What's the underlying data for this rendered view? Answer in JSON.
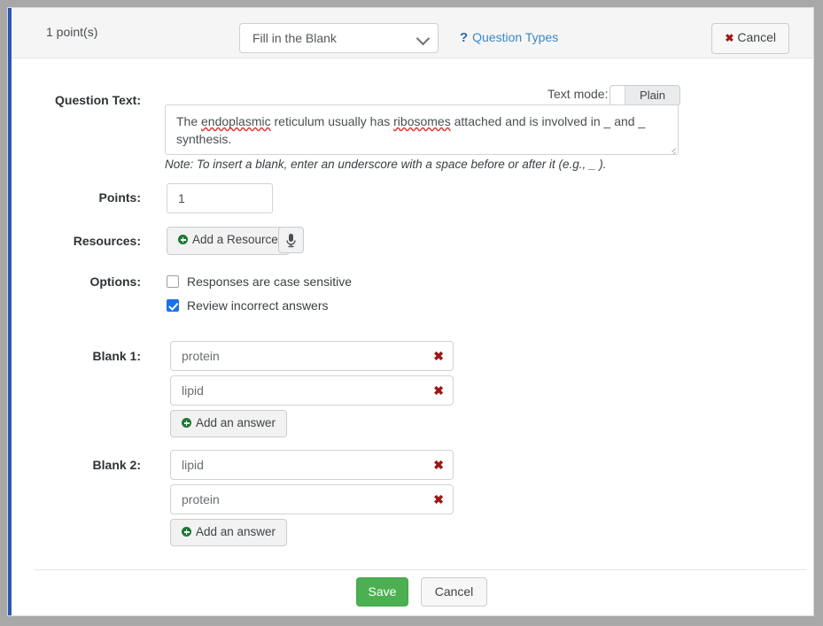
{
  "header": {
    "points_summary": "1 point(s)",
    "question_type": "Fill in the Blank",
    "question_types_link": "Question Types",
    "help_icon": "question-mark-icon",
    "cancel_label": "Cancel",
    "cancel_icon": "x-mark-icon",
    "chevron_icon": "chevron-down-icon"
  },
  "question_text": {
    "label": "Question Text:",
    "text_mode_label": "Text mode:",
    "text_mode_value": "Plain",
    "value_part1": "The ",
    "value_misspelled1": "endoplasmic",
    "value_part2": " reticulum usually has ",
    "value_misspelled2": "ribosomes",
    "value_part3": " attached and is involved in _ and _ synthesis.",
    "full_value": "The endoplasmic reticulum usually has ribosomes attached and is involved in _ and _ synthesis.",
    "note": "Note: To insert a blank, enter an underscore with a space before or after it (e.g., _ )."
  },
  "points": {
    "label": "Points:",
    "value": "1"
  },
  "resources": {
    "label": "Resources:",
    "add_label": "Add a Resource",
    "add_icon": "plus-circle-icon",
    "mic_icon": "microphone-icon"
  },
  "options": {
    "label": "Options:",
    "items": [
      {
        "label": "Responses are case sensitive",
        "checked": false
      },
      {
        "label": "Review incorrect answers",
        "checked": true
      }
    ]
  },
  "blanks": [
    {
      "label": "Blank 1:",
      "answers": [
        "protein",
        "lipid"
      ],
      "add_answer_label": "Add an answer"
    },
    {
      "label": "Blank 2:",
      "answers": [
        "lipid",
        "protein"
      ],
      "add_answer_label": "Add an answer"
    }
  ],
  "remove_icon": "x-mark-icon",
  "footer": {
    "save_label": "Save",
    "cancel_label": "Cancel"
  },
  "colors": {
    "accent_blue": "#2b56b8",
    "link_blue": "#3c87c6",
    "save_green": "#4cb052",
    "add_icon_green": "#1d7a32",
    "remove_red": "#9d1717",
    "checkbox_blue": "#1a73e8",
    "spell_error_red": "#e03030"
  }
}
